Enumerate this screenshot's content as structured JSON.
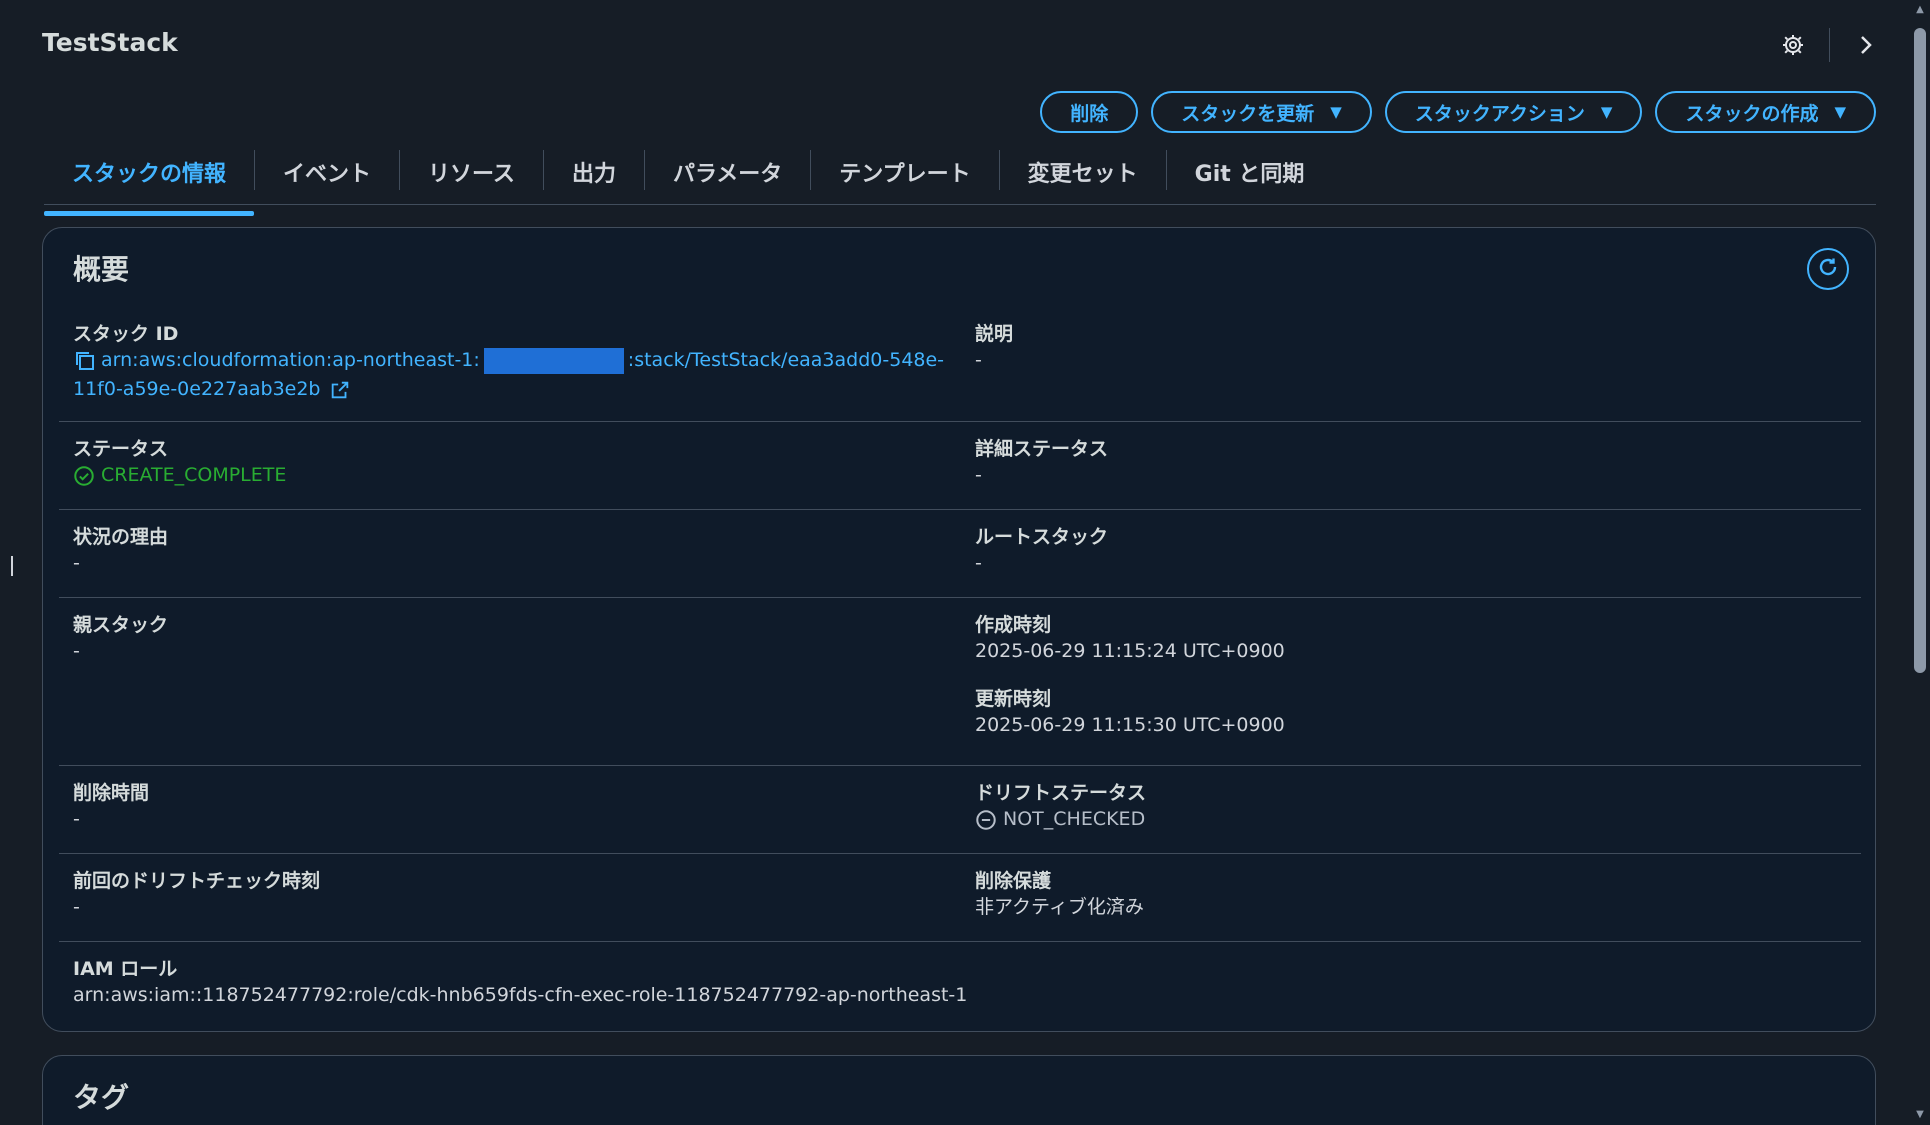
{
  "header": {
    "title": "TestStack",
    "icons": [
      "gear-icon",
      "chevron-right-icon"
    ]
  },
  "actions": {
    "delete": "削除",
    "update": "スタックを更新",
    "stack_actions": "スタックアクション",
    "create": "スタックの作成"
  },
  "tabs": [
    {
      "label": "スタックの情報",
      "active": true
    },
    {
      "label": "イベント"
    },
    {
      "label": "リソース"
    },
    {
      "label": "出力"
    },
    {
      "label": "パラメータ"
    },
    {
      "label": "テンプレート"
    },
    {
      "label": "変更セット"
    },
    {
      "label": "Git と同期"
    }
  ],
  "overview": {
    "title": "概要",
    "stack_id_label": "スタック ID",
    "stack_id_prefix": "arn:aws:cloudformation:ap-northeast-1:",
    "stack_id_suffix": ":stack/TestStack/eaa3add0-548e-",
    "stack_id_line2": "11f0-a59e-0e227aab3e2b",
    "description_label": "説明",
    "description_value": "-",
    "status_label": "ステータス",
    "status_value": "CREATE_COMPLETE",
    "detailed_status_label": "詳細ステータス",
    "detailed_status_value": "-",
    "reason_label": "状況の理由",
    "reason_value": "-",
    "root_stack_label": "ルートスタック",
    "root_stack_value": "-",
    "parent_stack_label": "親スタック",
    "parent_stack_value": "-",
    "created_label": "作成時刻",
    "created_value": "2025-06-29 11:15:24 UTC+0900",
    "updated_label": "更新時刻",
    "updated_value": "2025-06-29 11:15:30 UTC+0900",
    "deletion_time_label": "削除時間",
    "deletion_time_value": "-",
    "drift_status_label": "ドリフトステータス",
    "drift_status_value": "NOT_CHECKED",
    "last_drift_label": "前回のドリフトチェック時刻",
    "last_drift_value": "-",
    "termination_protection_label": "削除保護",
    "termination_protection_value": "非アクティブ化済み",
    "iam_role_label": "IAM ロール",
    "iam_role_value": "arn:aws:iam::118752477792:role/cdk-hnb659fds-cfn-exec-role-118752477792-ap-northeast-1"
  },
  "tags": {
    "title": "タグ"
  },
  "colors": {
    "accent": "#42b4ff",
    "success": "#29ad32",
    "background": "#161d26",
    "panel": "#0f1b2a",
    "redaction": "#1f6fd6"
  }
}
